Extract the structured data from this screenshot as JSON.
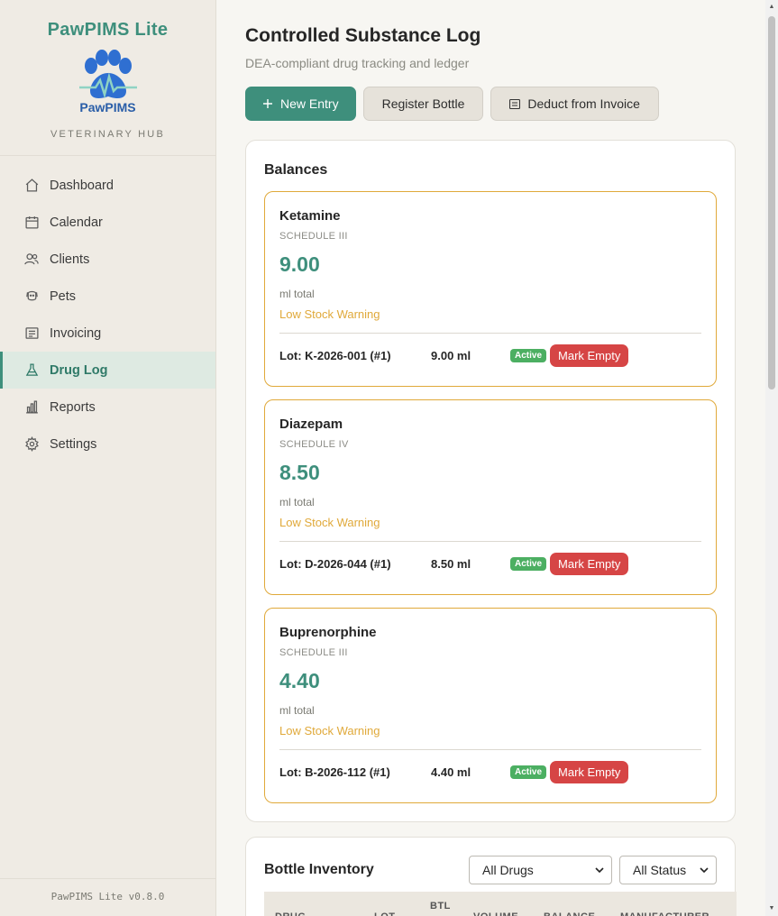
{
  "sidebar": {
    "brand_title": "PawPIMS Lite",
    "logo_text": "PawPIMS",
    "brand_subtitle": "VETERINARY HUB",
    "items": [
      {
        "label": "Dashboard",
        "icon": "home-icon"
      },
      {
        "label": "Calendar",
        "icon": "calendar-icon"
      },
      {
        "label": "Clients",
        "icon": "users-icon"
      },
      {
        "label": "Pets",
        "icon": "pet-icon"
      },
      {
        "label": "Invoicing",
        "icon": "invoice-icon"
      },
      {
        "label": "Drug Log",
        "icon": "flask-icon",
        "active": true
      },
      {
        "label": "Reports",
        "icon": "bar-chart-icon"
      },
      {
        "label": "Settings",
        "icon": "gear-icon"
      }
    ],
    "version": "PawPIMS Lite v0.8.0"
  },
  "header": {
    "title": "Controlled Substance Log",
    "subtitle": "DEA-compliant drug tracking and ledger"
  },
  "toolbar": {
    "new_entry": "New Entry",
    "register_bottle": "Register Bottle",
    "deduct_invoice": "Deduct from Invoice"
  },
  "balances": {
    "title": "Balances",
    "drugs": [
      {
        "name": "Ketamine",
        "schedule": "SCHEDULE III",
        "total": "9.00",
        "unit": "ml total",
        "warning": "Low Stock Warning",
        "lot": "Lot: K-2026-001 (#1)",
        "volume": "9.00 ml",
        "status": "Active",
        "action": "Mark Empty"
      },
      {
        "name": "Diazepam",
        "schedule": "SCHEDULE IV",
        "total": "8.50",
        "unit": "ml total",
        "warning": "Low Stock Warning",
        "lot": "Lot: D-2026-044 (#1)",
        "volume": "8.50 ml",
        "status": "Active",
        "action": "Mark Empty"
      },
      {
        "name": "Buprenorphine",
        "schedule": "SCHEDULE III",
        "total": "4.40",
        "unit": "ml total",
        "warning": "Low Stock Warning",
        "lot": "Lot: B-2026-112 (#1)",
        "volume": "4.40 ml",
        "status": "Active",
        "action": "Mark Empty"
      }
    ]
  },
  "inventory": {
    "title": "Bottle Inventory",
    "drug_filter": "All Drugs",
    "status_filter": "All Status",
    "columns": [
      "DRUG",
      "LOT",
      "BTL",
      "VOLUME",
      "BALANCE",
      "MANUFACTURER"
    ]
  },
  "colors": {
    "accent": "#3e8f7c",
    "warning": "#e0a93a",
    "danger": "#d64545",
    "success": "#4caf62"
  }
}
